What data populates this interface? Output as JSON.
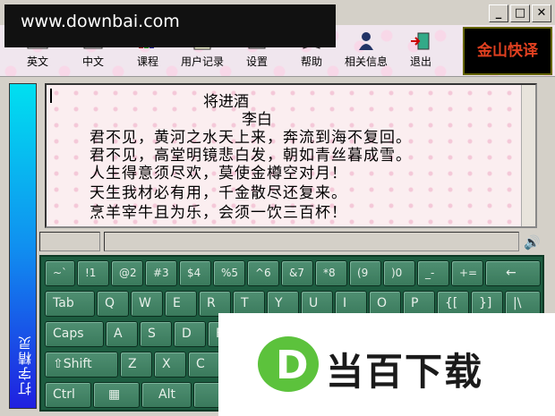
{
  "watermark": "www.downbai.com",
  "window_controls": {
    "minimize": "_",
    "maximize": "□",
    "close": "✕"
  },
  "toolbar": {
    "items": [
      {
        "label": "英文",
        "icon": "ab-icon"
      },
      {
        "label": "中文",
        "icon": "chinese-icon"
      },
      {
        "label": "课程",
        "icon": "books-icon"
      },
      {
        "label": "用户记录",
        "icon": "record-icon"
      },
      {
        "label": "设置",
        "icon": "settings-icon"
      },
      {
        "label": "帮助",
        "icon": "help-book-icon"
      },
      {
        "label": "相关信息",
        "icon": "info-person-icon"
      },
      {
        "label": "退出",
        "icon": "exit-door-icon"
      }
    ],
    "brand": "金山快译"
  },
  "sidebar": {
    "label": "打字精灵"
  },
  "poem": {
    "title": "将进酒",
    "author": "李白",
    "lines": [
      "君不见，黄河之水天上来，奔流到海不复回。",
      "君不见，高堂明镜悲白发，朝如青丝暮成雪。",
      "人生得意须尽欢，莫使金樽空对月！",
      "天生我材必有用，千金散尽还复来。",
      "烹羊宰牛且为乐，会须一饮三百杯！"
    ]
  },
  "keyboard": {
    "row1": [
      "~`",
      "!1",
      "@2",
      "#3",
      "$4",
      "%5",
      "^6",
      "&7",
      "*8",
      "(9",
      ")0",
      "_-",
      "+=",
      "←"
    ],
    "row2": [
      "Tab",
      "Q",
      "W",
      "E",
      "R",
      "T",
      "Y",
      "U",
      "I",
      "O",
      "P",
      "{[",
      "}]",
      "|\\"
    ],
    "row3": [
      "Caps",
      "A",
      "S",
      "D",
      "F"
    ],
    "row4": [
      "⇧Shift",
      "Z",
      "X",
      "C"
    ],
    "row5": [
      "Ctrl",
      "▦",
      "Alt"
    ]
  },
  "overlay_brand": {
    "letter": "D",
    "text": "当百下载",
    "color": "#5cc23c"
  }
}
